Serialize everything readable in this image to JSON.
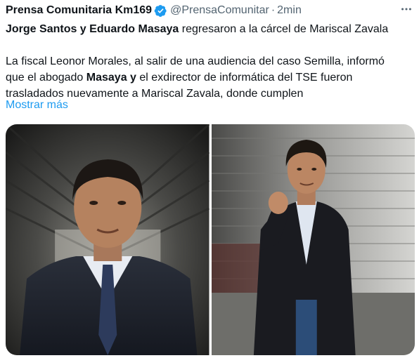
{
  "tweet": {
    "author": "Prensa Comunitaria Km169",
    "handle": "@PrensaComunitar",
    "separator": "·",
    "time": "2min",
    "headline_bold": "Jorge Santos y Eduardo Masaya",
    "headline_rest": " regresaron a la cárcel de Mariscal Zavala",
    "body": {
      "line1": "La fiscal Leonor Morales, al salir de una audiencia del caso Semilla, informó",
      "line2_pre": "que el abogado ",
      "line2_bold": "Masaya y",
      "line2_post": " el exdirector de informática del TSE fueron",
      "line3": "trasladados nuevamente a Mariscal Zavala, donde cumplen"
    },
    "show_more": "Mostrar más"
  },
  "colors": {
    "text": "#0f1419",
    "secondary": "#536471",
    "link": "#1d9bf0",
    "verified": "#1d9bf0"
  },
  "icons": {
    "verified": "verified-badge-icon",
    "more": "more-horizontal-icon"
  }
}
